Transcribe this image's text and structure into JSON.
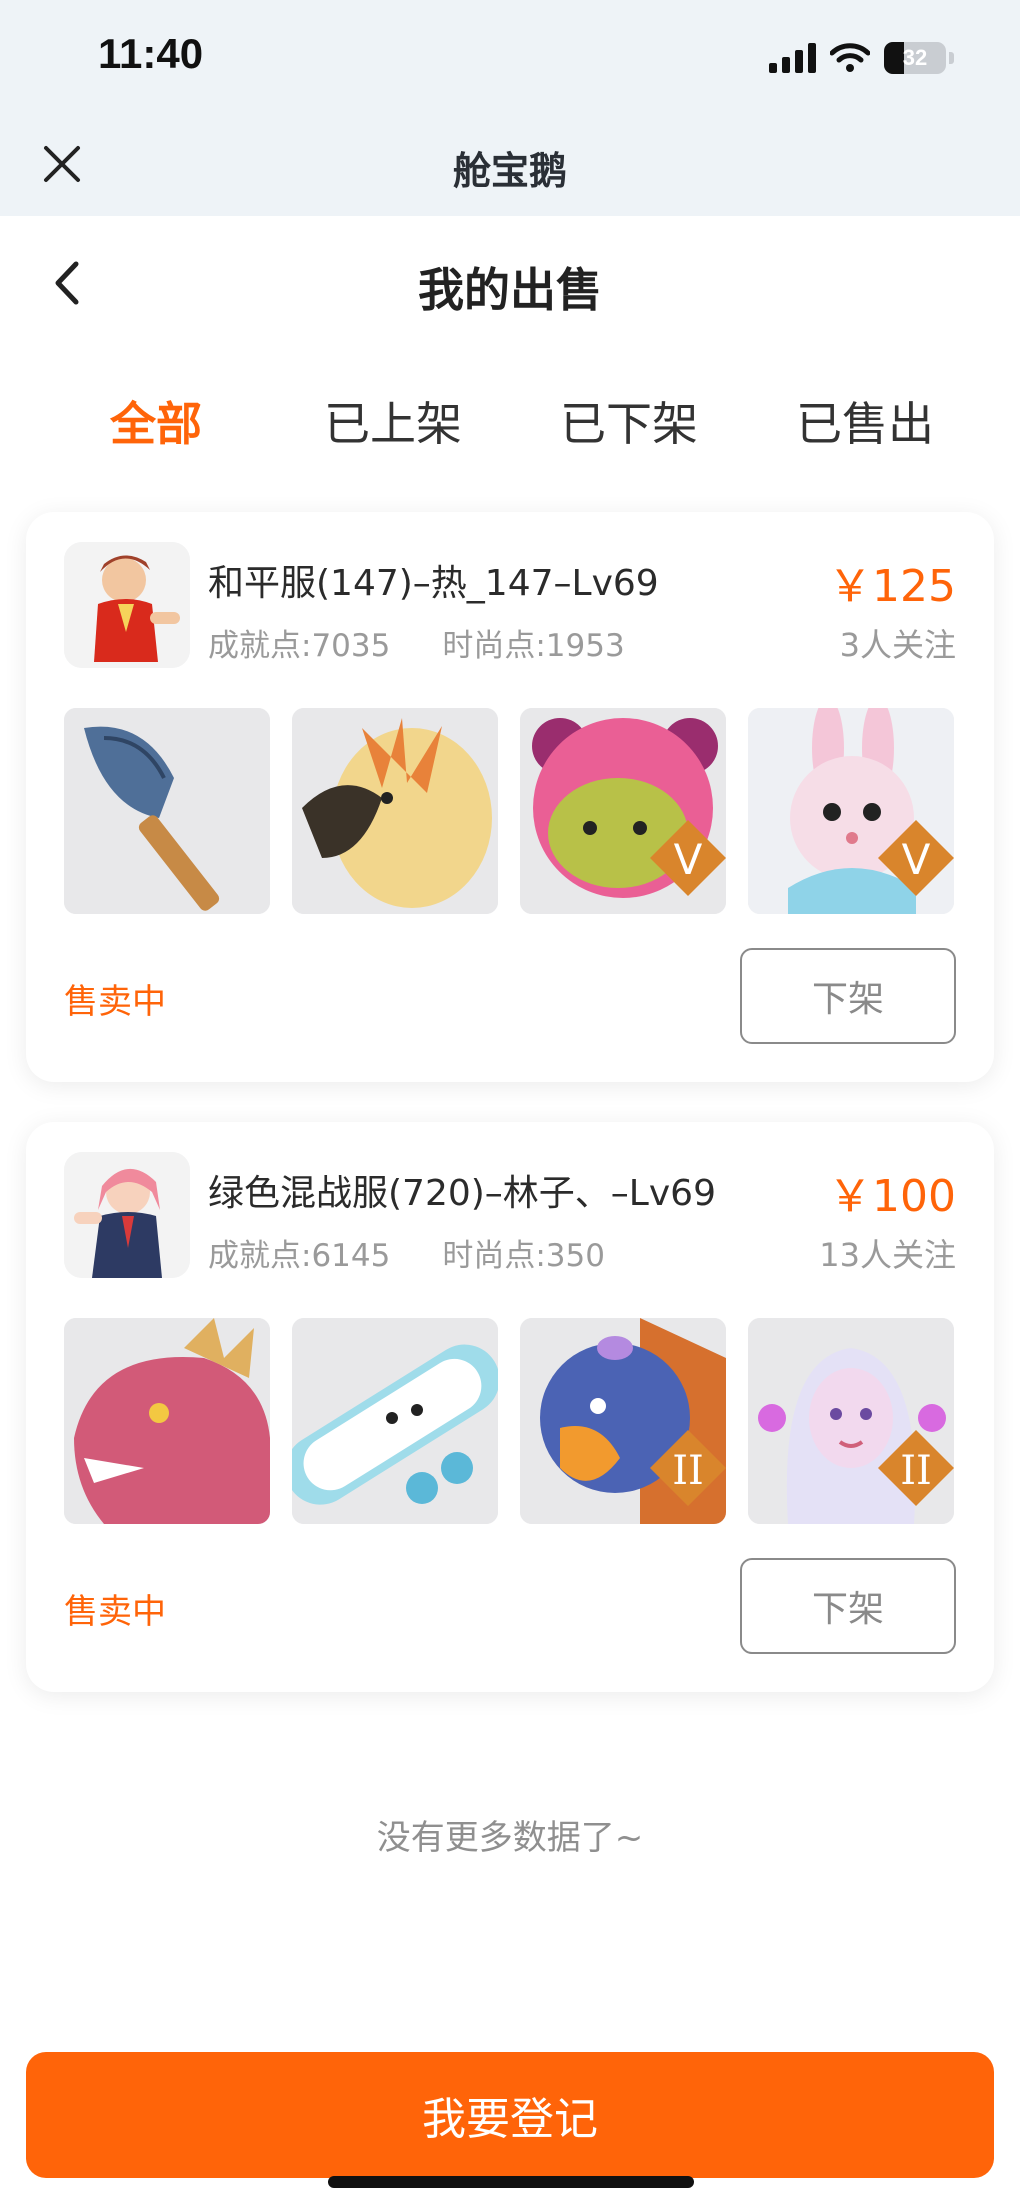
{
  "status_bar": {
    "time": "11:40",
    "battery": "32"
  },
  "mini_app": {
    "title": "舱宝鹅"
  },
  "header": {
    "title": "我的出售"
  },
  "tabs": [
    {
      "label": "全部",
      "active": true
    },
    {
      "label": "已上架",
      "active": false
    },
    {
      "label": "已下架",
      "active": false
    },
    {
      "label": "已售出",
      "active": false
    }
  ],
  "listings": [
    {
      "title": "和平服(147)–热_147–Lv69",
      "achievement": "成就点:7035",
      "fashion": "时尚点:1953",
      "price": "￥125",
      "watchers": "3人关注",
      "status": "售卖中",
      "action": "下架",
      "thumb_badges": [
        "",
        "",
        "V",
        "V"
      ]
    },
    {
      "title": "绿色混战服(720)–林子、–Lv69",
      "achievement": "成就点:6145",
      "fashion": "时尚点:350",
      "price": "￥100",
      "watchers": "13人关注",
      "status": "售卖中",
      "action": "下架",
      "thumb_badges": [
        "",
        "",
        "II",
        "II"
      ]
    }
  ],
  "footer": {
    "no_more": "没有更多数据了~",
    "register_button": "我要登记"
  },
  "colors": {
    "accent": "#ff6409",
    "header_bg": "#eef3f7"
  }
}
